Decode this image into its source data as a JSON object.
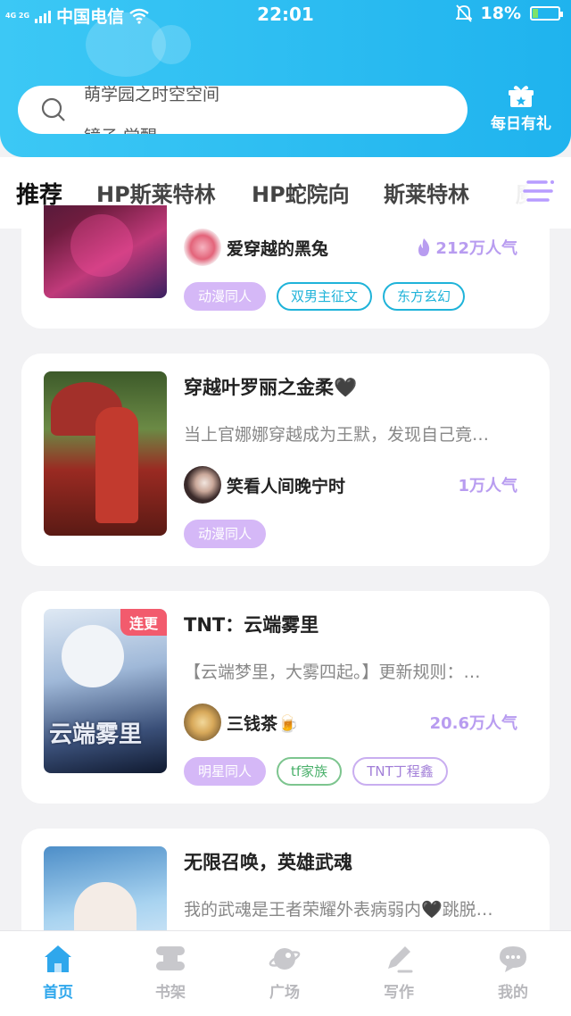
{
  "status_bar": {
    "network": "4G 2G",
    "carrier": "中国电信",
    "time": "22:01",
    "battery": "18%"
  },
  "search": {
    "line1": "萌学园之时空空间",
    "line2": "镜子 觉醒"
  },
  "gift": {
    "label": "每日有礼"
  },
  "tabs": [
    {
      "label": "推荐",
      "active": true
    },
    {
      "label": "HP斯莱特林"
    },
    {
      "label": "HP蛇院向"
    },
    {
      "label": "斯莱特林"
    },
    {
      "label": "魔"
    }
  ],
  "books": [
    {
      "title": "",
      "author": "爱穿越的黑兔",
      "popularity": "212万人气",
      "tags": [
        "动漫同人",
        "双男主征文",
        "东方玄幻"
      ]
    },
    {
      "title": "穿越叶罗丽之金柔🖤",
      "desc": "当上官娜娜穿越成为王默，发现自己竟…",
      "author": "笑看人间晚宁时",
      "popularity": "1万人气",
      "tags": [
        "动漫同人"
      ]
    },
    {
      "badge": "连更",
      "title": "TNT：云端雾里",
      "desc": "【云端梦里，大雾四起。】更新规则：…",
      "author": "三钱茶🍺",
      "popularity": "20.6万人气",
      "tags": [
        "明星同人",
        "tf家族",
        "TNT丁程鑫"
      ]
    },
    {
      "title": "无限召唤，英雄武魂",
      "desc": "我的武魂是王者荣耀外表病弱内🖤跳脱…"
    }
  ],
  "nav": [
    {
      "label": "首页",
      "icon": "home-icon",
      "active": true
    },
    {
      "label": "书架",
      "icon": "bookshelf-icon"
    },
    {
      "label": "广场",
      "icon": "planet-icon"
    },
    {
      "label": "写作",
      "icon": "pen-icon"
    },
    {
      "label": "我的",
      "icon": "chat-icon"
    }
  ],
  "colors": {
    "accent": "#1fb3ee",
    "tag_purple": "#d5b8f7",
    "popularity": "#b89cf0",
    "badge": "#f25b6d"
  }
}
